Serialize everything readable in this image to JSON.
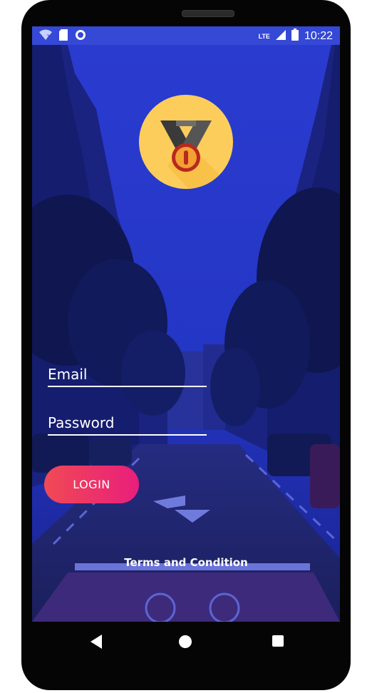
{
  "status_bar": {
    "time": "10:22",
    "network": "LTE"
  },
  "form": {
    "email_label": "Email",
    "password_label": "Password",
    "login_label": "LOGIN",
    "terms_label": "Terms and Condition"
  },
  "colors": {
    "status_bar": "#3548d6",
    "overlay_blue": "#2233cc",
    "medal_bg": "#fdcd5c",
    "login_start": "#f04a55",
    "login_end": "#e91e7b"
  },
  "icons": {
    "logo": "medal-icon",
    "wifi": "wifi-icon",
    "sd": "sd-card-icon",
    "sync": "circle-icon",
    "signal": "signal-icon",
    "battery": "battery-icon",
    "back": "back-icon",
    "home": "home-icon",
    "recent": "recent-apps-icon"
  }
}
